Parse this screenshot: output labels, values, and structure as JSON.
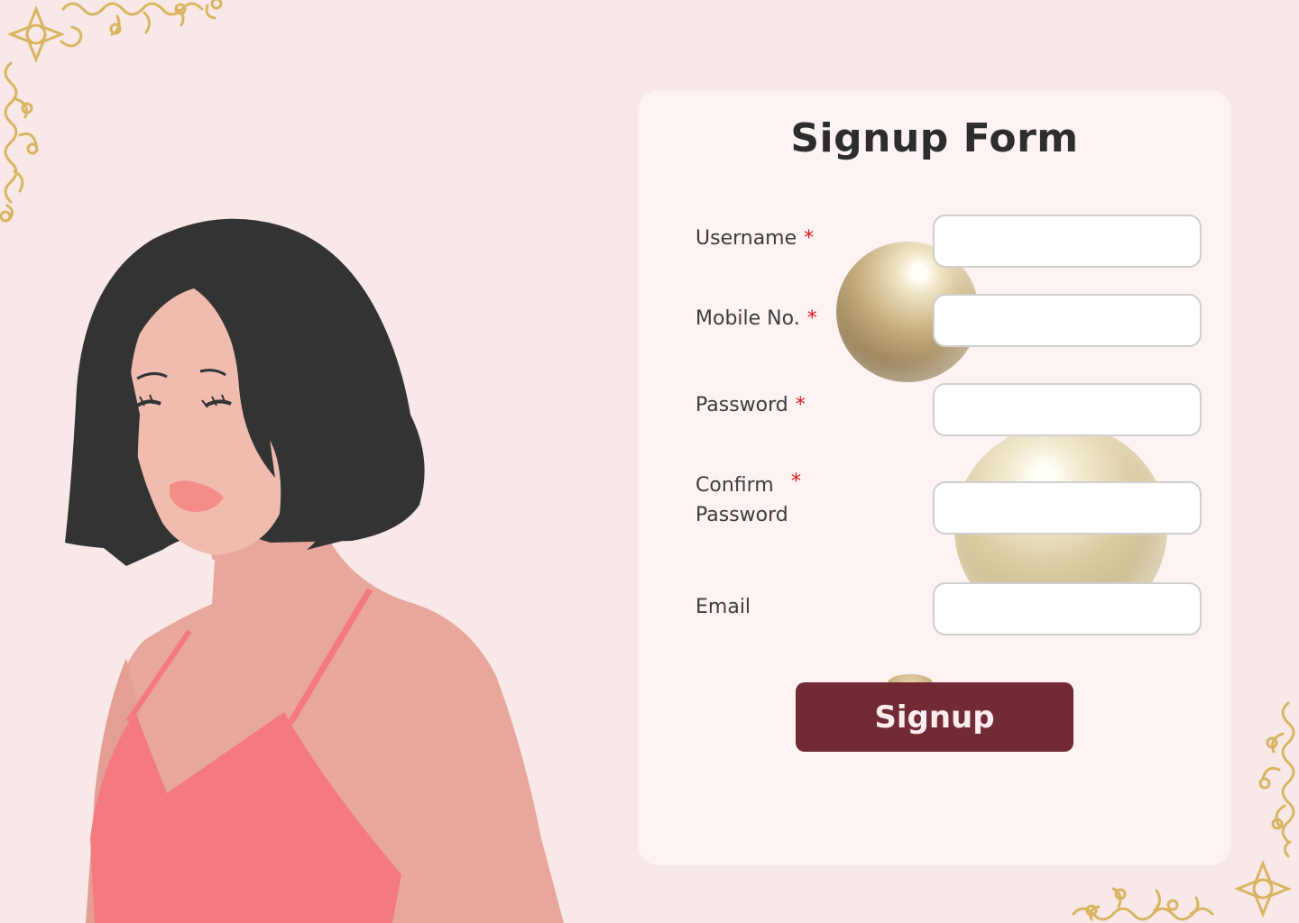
{
  "form": {
    "title": "Signup Form",
    "required_marker": "*",
    "fields": [
      {
        "label": "Username",
        "required": true,
        "value": "",
        "placeholder": ""
      },
      {
        "label": "Mobile No.",
        "required": true,
        "value": "",
        "placeholder": ""
      },
      {
        "label": "Password",
        "required": true,
        "value": "",
        "placeholder": ""
      },
      {
        "label_line1": "Confirm",
        "label_line2": "Password",
        "required": true,
        "value": "",
        "placeholder": ""
      },
      {
        "label": "Email",
        "required": false,
        "value": "",
        "placeholder": ""
      }
    ],
    "submit_label": "Signup"
  },
  "colors": {
    "background": "#f8e9e8",
    "card": "#fcf3f2",
    "button": "#722b35",
    "button_text": "#fbecee",
    "required_star": "#e0131b",
    "ornament_gold": "#d9b461"
  },
  "decor": {
    "illustration": "woman-portrait-illustration",
    "ornaments": [
      "gold-filigree-ornament-top-left",
      "gold-filigree-ornament-bottom-right"
    ],
    "pearls": [
      "pearl-decoration",
      "pearl-decoration",
      "pearl-decoration"
    ]
  }
}
